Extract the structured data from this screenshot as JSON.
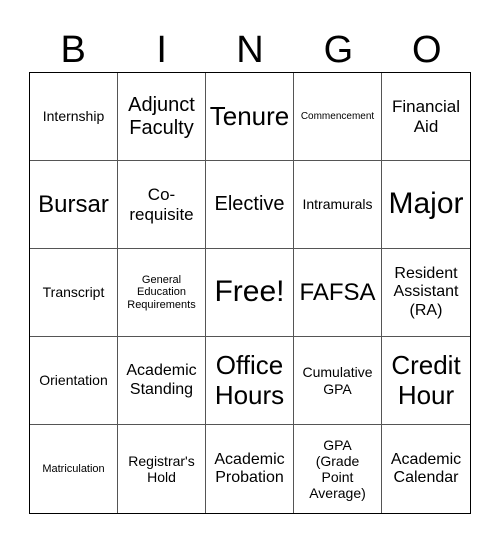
{
  "header": [
    "B",
    "I",
    "N",
    "G",
    "O"
  ],
  "cells": [
    "Internship",
    "Adjunct Faculty",
    "Tenure",
    "Commencement",
    "Financial Aid",
    "Bursar",
    "Co-requisite",
    "Elective",
    "Intramurals",
    "Major",
    "Transcript",
    "General Education Requirements",
    "Free!",
    "FAFSA",
    "Resident Assistant (RA)",
    "Orientation",
    "Academic Standing",
    "Office Hours",
    "Cumulative GPA",
    "Credit Hour",
    "Matriculation",
    "Registrar's Hold",
    "Academic Probation",
    "GPA (Grade Point Average)",
    "Academic Calendar"
  ]
}
